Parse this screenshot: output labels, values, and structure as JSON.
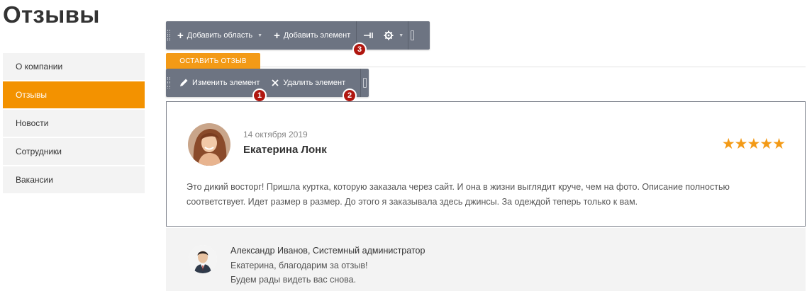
{
  "page": {
    "title": "Отзывы"
  },
  "sidebar": {
    "items": [
      {
        "label": "О компании",
        "active": false
      },
      {
        "label": "Отзывы",
        "active": true
      },
      {
        "label": "Новости",
        "active": false
      },
      {
        "label": "Сотрудники",
        "active": false
      },
      {
        "label": "Вакансии",
        "active": false
      }
    ]
  },
  "toolbar_top": {
    "add_area_label": "Добавить область",
    "add_element_label": "Добавить элемент",
    "badge": "3",
    "icons": [
      "plus-icon",
      "plus-icon",
      "pin-icon",
      "gear-icon"
    ]
  },
  "toolbar_element": {
    "edit_label": "Изменить элемент",
    "delete_label": "Удалить элемент",
    "badge_edit": "1",
    "badge_delete": "2",
    "icons": [
      "pencil-icon",
      "close-icon"
    ]
  },
  "tabs": {
    "leave_review": "Оставить отзыв"
  },
  "review": {
    "date": "14 октября 2019",
    "author": "Екатерина Лонк",
    "rating": 5,
    "stars": "★★★★★",
    "text": "Это дикий восторг! Пришла куртка, которую заказала через сайт. И она в жизни выглядит круче, чем на фото. Описание полностью соответствует. Идет размер в размер. До этого я заказывала здесь джинсы. За одеждой теперь только к вам."
  },
  "reply": {
    "author": "Александр Иванов, Системный администратор",
    "line1": "Екатерина, благодарим за отзыв!",
    "line2": "Будем рады видеть вас снова."
  },
  "colors": {
    "accent": "#f39200",
    "toolbar": "#6d7482",
    "badge": "#b0160f",
    "star": "#f39a16"
  }
}
